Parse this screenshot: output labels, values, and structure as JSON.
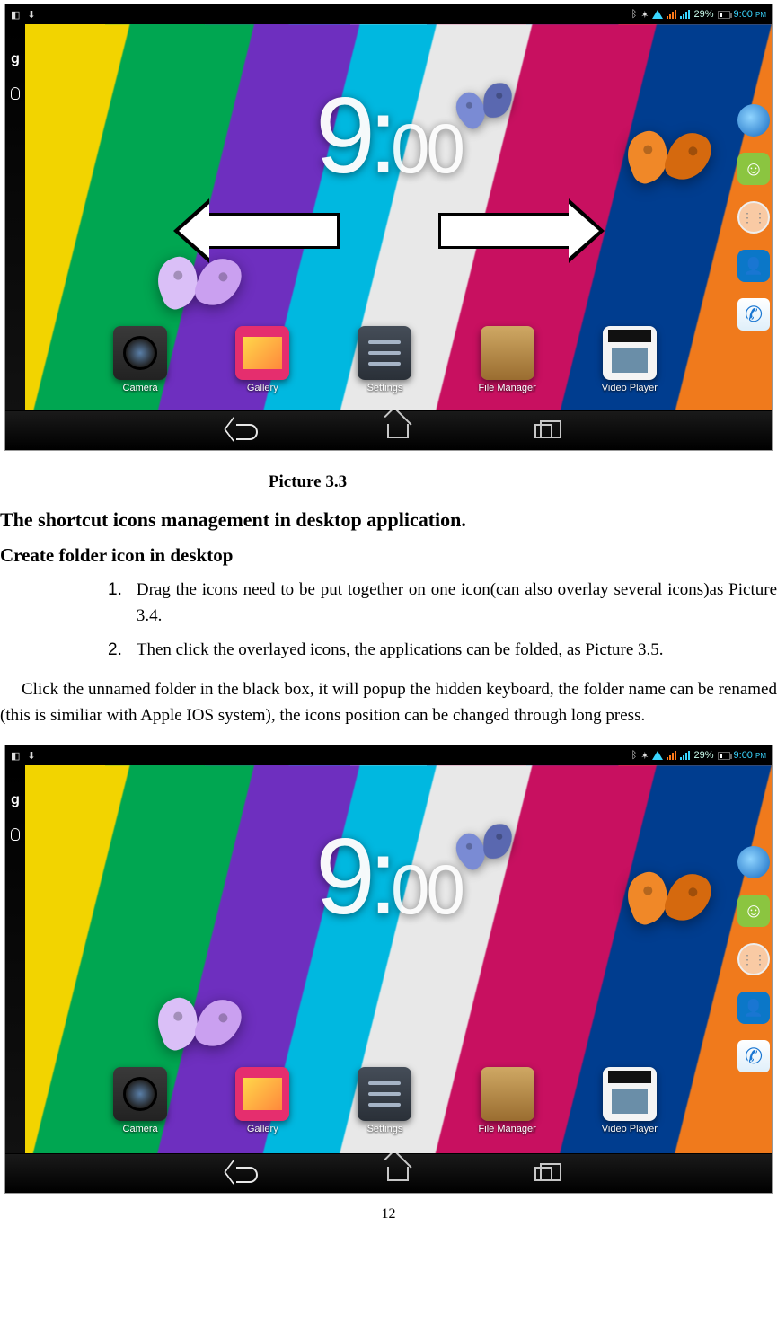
{
  "statusbar": {
    "bt": "⟡",
    "battery_pct": "29%",
    "time": "9:00",
    "ampm": "PM"
  },
  "clock": {
    "hour": "9",
    "minute": "00"
  },
  "right_icons": {
    "browser": "browser-icon",
    "messaging": ":)",
    "apps": "•••",
    "contacts": "👤",
    "phone": "📞"
  },
  "dock": [
    {
      "label": "Camera"
    },
    {
      "label": "Gallery"
    },
    {
      "label": "Settings"
    },
    {
      "label": "File Manager"
    },
    {
      "label": "Video Player"
    }
  ],
  "doc": {
    "caption1": "Picture 3.3",
    "h2": "The shortcut icons management in desktop application.",
    "h3": "Create folder icon in desktop",
    "li1_num": "1.",
    "li1": "Drag the icons need to be put together on one icon(can also overlay several icons)as Picture 3.4.",
    "li2_num": "2.",
    "li2": "Then click the overlayed icons, the applications can be folded, as Picture 3.5.",
    "para": "Click the unnamed folder in the black box, it will popup the hidden keyboard, the folder name can be renamed (this is similiar with Apple IOS system), the icons position can be changed through long press.",
    "pagenum": "12"
  }
}
